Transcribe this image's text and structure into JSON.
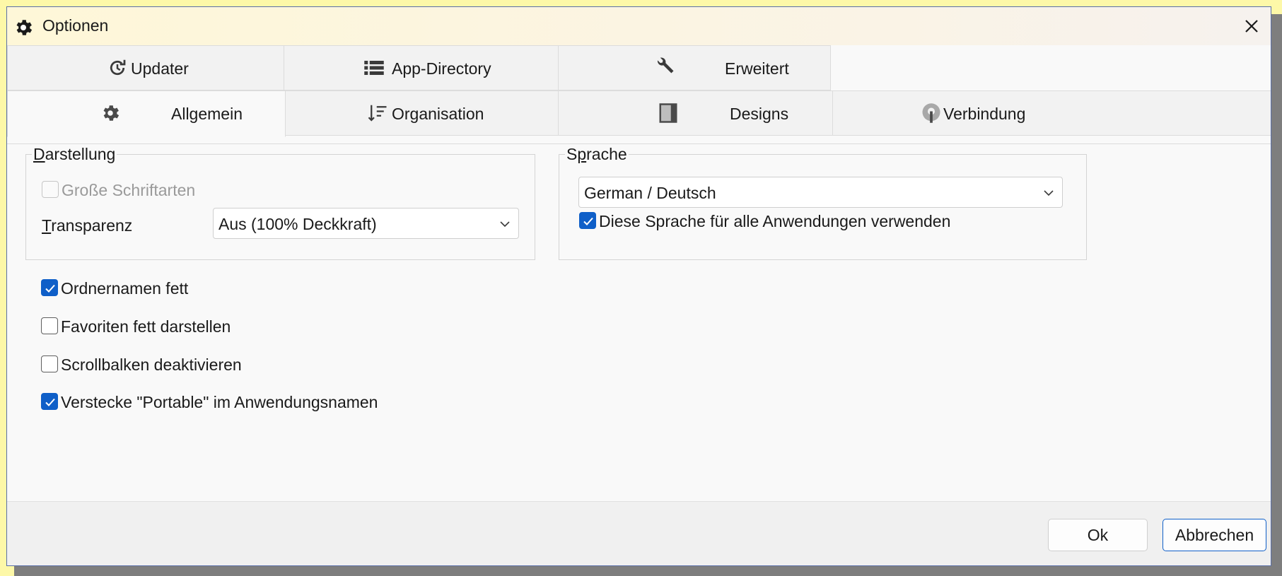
{
  "window": {
    "title": "Optionen"
  },
  "tabs_back": [
    {
      "label": "Updater",
      "icon": "refresh-clock-icon"
    },
    {
      "label": "App-Directory",
      "icon": "list-icon"
    },
    {
      "label": "Erweitert",
      "icon": "wrench-icon"
    }
  ],
  "tabs_front": [
    {
      "label": "Allgemein",
      "icon": "gear-icon",
      "active": true
    },
    {
      "label": "Organisation",
      "icon": "sort-icon"
    },
    {
      "label": "Designs",
      "icon": "theme-icon"
    },
    {
      "label": "Verbindung",
      "icon": "connection-icon"
    }
  ],
  "darstellung": {
    "legend_first": "D",
    "legend_rest": "arstellung",
    "large_fonts": {
      "label": "Große Schriftarten",
      "checked": false,
      "disabled": true
    },
    "transparency": {
      "label_first": "T",
      "label_rest": "ransparenz",
      "value": "Aus (100% Deckkraft)"
    }
  },
  "sprache": {
    "legend_first": "S",
    "legend_ul": "p",
    "legend_rest": "rache",
    "language_value": "German / Deutsch",
    "use_for_all": {
      "label": "Diese Sprache für alle Anwendungen verwenden",
      "checked": true
    }
  },
  "options": [
    {
      "label": "Ordnernamen fett",
      "checked": true
    },
    {
      "label": "Favoriten fett darstellen",
      "checked": false
    },
    {
      "label": "Scrollbalken deaktivieren",
      "checked": false
    },
    {
      "label": "Verstecke \"Portable\" im Anwendungsnamen",
      "checked": true
    }
  ],
  "buttons": {
    "ok": "Ok",
    "cancel": "Abbrechen"
  },
  "colors": {
    "accent": "#0f5fc8",
    "background": "#fdf8a8"
  }
}
